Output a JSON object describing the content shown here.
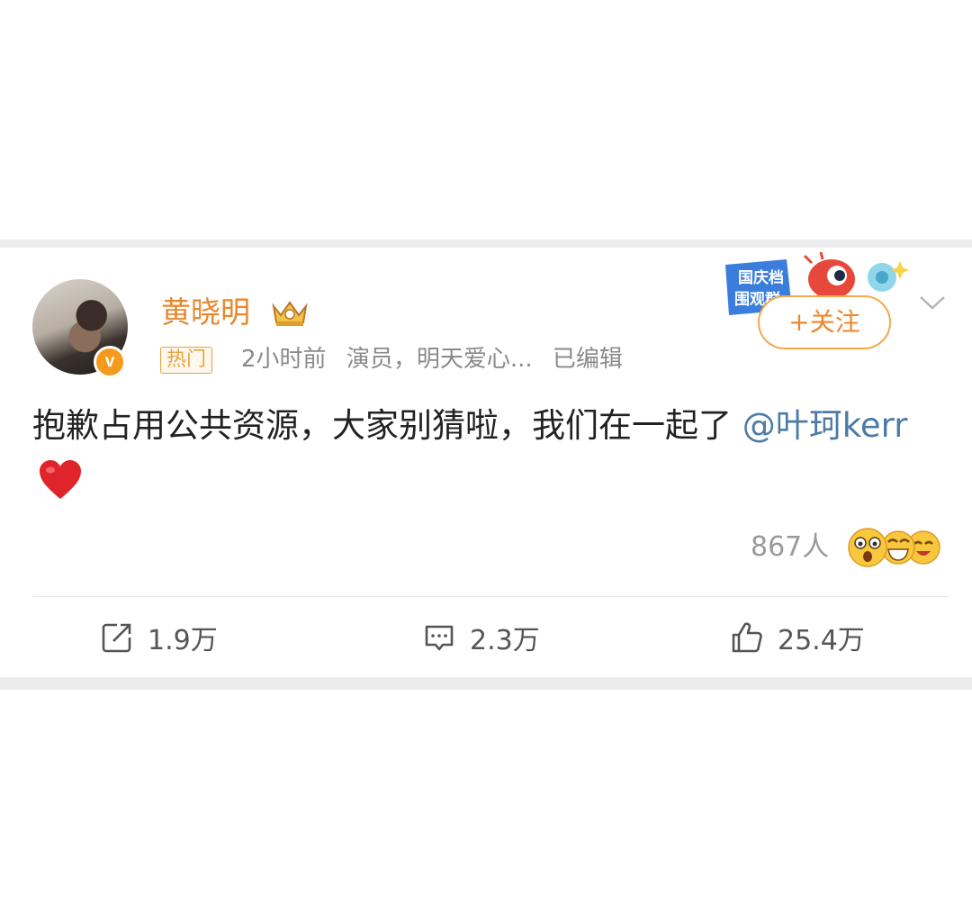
{
  "post": {
    "username": "黄晓明",
    "hot_tag": "热门",
    "time": "2小时前",
    "source": "演员，明天爱心...",
    "edited": "已编辑",
    "follow_label": "+关注",
    "text_main": "抱歉占用公共资源，大家别猜啦，我们在一起了",
    "mention": "@叶珂kerr",
    "reaction_count": "867人"
  },
  "promo": {
    "line1": "国庆档",
    "line2": "围观群"
  },
  "actions": {
    "repost": "1.9万",
    "comment": "2.3万",
    "like": "25.4万"
  },
  "colors": {
    "username": "#e8872b",
    "mention": "#4d7ba6",
    "follow": "#f0862a"
  }
}
